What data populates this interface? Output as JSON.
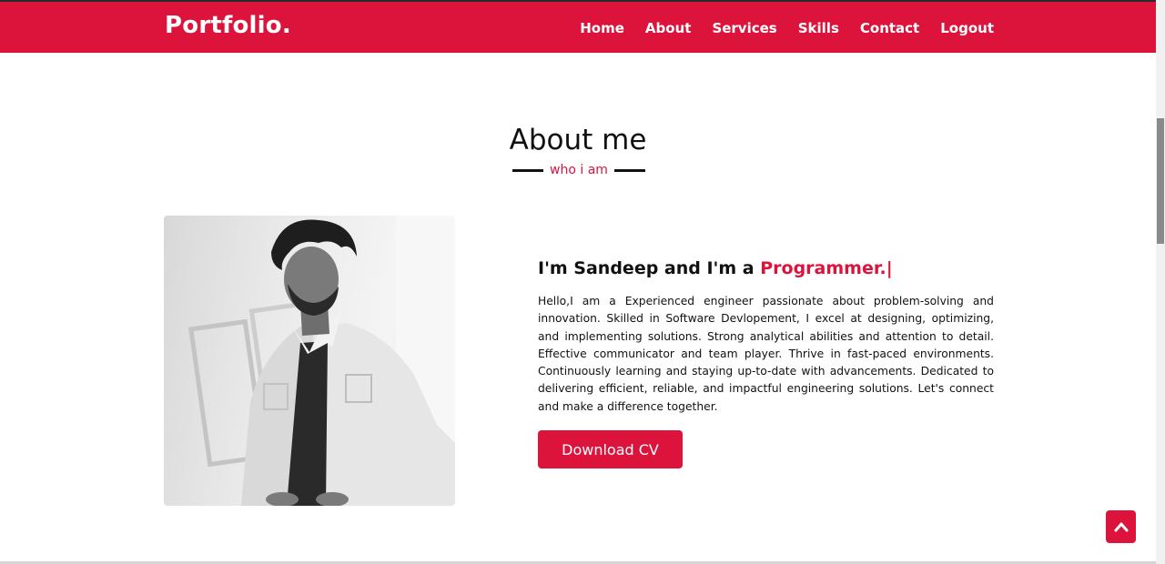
{
  "navbar": {
    "logo": "Portfolio.",
    "links": [
      {
        "label": "Home"
      },
      {
        "label": "About"
      },
      {
        "label": "Services"
      },
      {
        "label": "Skills"
      },
      {
        "label": "Contact"
      },
      {
        "label": "Logout"
      }
    ]
  },
  "about": {
    "title": "About me",
    "subtitle": "who i am",
    "heading_prefix": "I'm Sandeep and I'm a ",
    "heading_role": "Programmer.|",
    "description": "Hello,I am a Experienced engineer passionate about problem-solving and innovation. Skilled in Software Devlopement, I excel at designing, optimizing, and implementing solutions. Strong analytical abilities and attention to detail. Effective communicator and team player. Thrive in fast-paced environments. Continuously learning and staying up-to-date with advancements. Dedicated to delivering efficient, reliable, and impactful engineering solutions. Let's connect and make a difference together.",
    "download_label": "Download CV"
  },
  "icons": {
    "scroll_top": "chevron-up-icon"
  },
  "colors": {
    "accent": "#dc143c",
    "text": "#111111",
    "background": "#ffffff"
  }
}
